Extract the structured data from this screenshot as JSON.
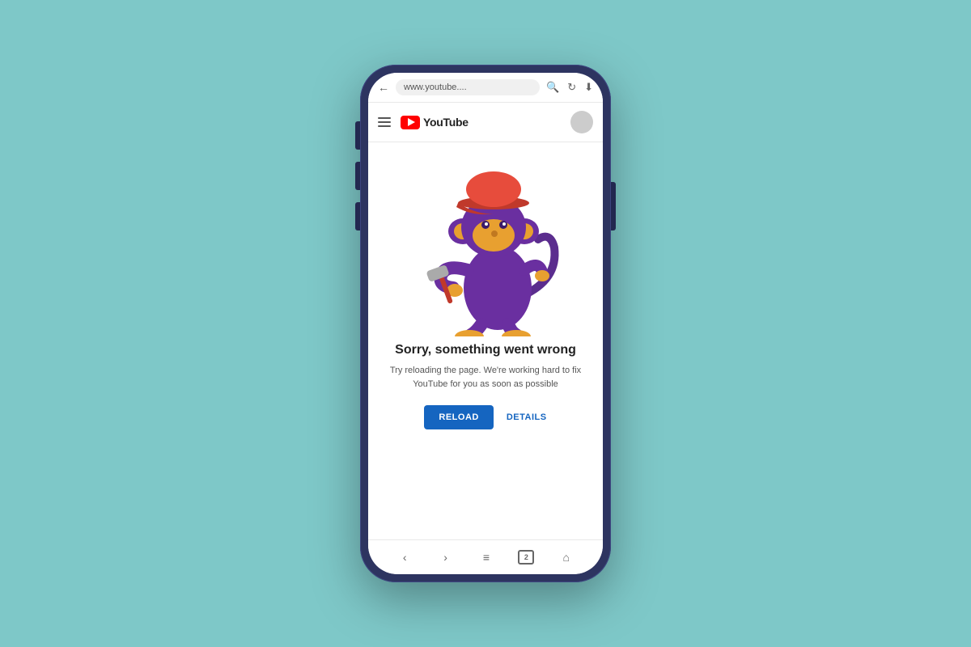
{
  "background_color": "#7ec8c8",
  "phone": {
    "outer_color": "#2d3460"
  },
  "browser": {
    "url": "www.youtube....",
    "back_icon": "←",
    "search_icon": "🔍",
    "refresh_icon": "↻",
    "download_icon": "⬇"
  },
  "youtube": {
    "logo_text": "YouTube",
    "logo_icon": "yt-icon"
  },
  "error_page": {
    "title": "Sorry, something went wrong",
    "description": "Try reloading the page. We're working hard to fix YouTube\nfor you as soon as possible",
    "reload_button": "RELOAD",
    "details_button": "DETAILS"
  },
  "bottom_nav": {
    "back": "‹",
    "forward": "›",
    "menu": "≡",
    "tabs_count": "2",
    "home": "⌂"
  }
}
